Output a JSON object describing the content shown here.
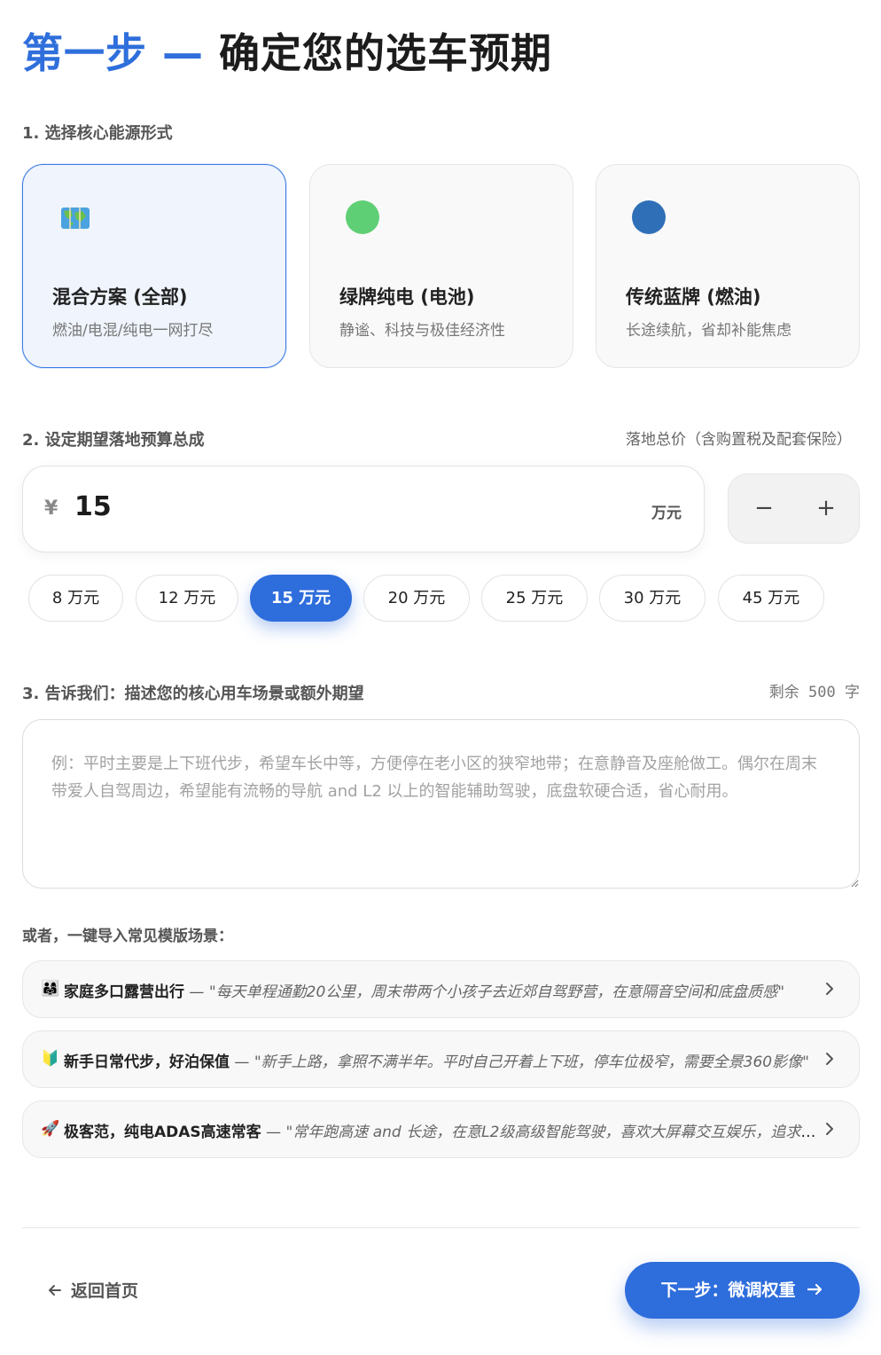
{
  "header": {
    "title_accent": "第一步",
    "title_dash": "—",
    "title_rest": "确定您的选车预期"
  },
  "energy": {
    "label": "1. 选择核心能源形式",
    "options": [
      {
        "title": "混合方案 (全部)",
        "subtitle": "燃油/电混/纯电一网打尽",
        "icon": "world-map-icon",
        "selected": true
      },
      {
        "title": "绿牌纯电 (电池)",
        "subtitle": "静谧、科技与极佳经济性",
        "icon": "green-dot-icon",
        "color": "#5fcf75"
      },
      {
        "title": "传统蓝牌 (燃油)",
        "subtitle": "长途续航，省却补能焦虑",
        "icon": "blue-dot-icon",
        "color": "#2e6fb8"
      }
    ]
  },
  "budget": {
    "label": "2. 设定期望落地预算总成",
    "hint": "落地总价（含购置税及配套保险）",
    "currency": "¥",
    "value": "15",
    "unit": "万元",
    "minus": "−",
    "plus": "+",
    "presets": [
      "8 万元",
      "12 万元",
      "15 万元",
      "20 万元",
      "25 万元",
      "30 万元",
      "45 万元"
    ],
    "active_preset": "15 万元"
  },
  "scene": {
    "label": "3. 告诉我们：描述您的核心用车场景或额外期望",
    "remain_prefix": "剩余",
    "remain_count": "500",
    "remain_suffix": "字",
    "placeholder": "例：平时主要是上下班代步，希望车长中等，方便停在老小区的狭窄地带；在意静音及座舱做工。偶尔在周末带爱人自驾周边，希望能有流畅的导航 and L2 以上的智能辅助驾驶，底盘软硬合适，省心耐用。"
  },
  "templates": {
    "label": "或者，一键导入常见模版场景：",
    "items": [
      {
        "emoji": "👨‍👩‍👧",
        "title": "家庭多口露营出行",
        "sep": " — ",
        "desc": "\"每天单程通勤20公里，周末带两个小孩子去近郊自驾野营，在意隔音空间和底盘质感\""
      },
      {
        "emoji": "🔰",
        "title": "新手日常代步，好泊保值",
        "sep": " — ",
        "desc": "\"新手上路，拿照不满半年。平时自己开着上下班，停车位极窄，需要全景360影像\""
      },
      {
        "emoji": "🚀",
        "title": "极客范，纯电ADAS高速常客",
        "sep": " — ",
        "desc": "\"常年跑高速 and 长途，在意L2级高级智能驾驶，喜欢大屏幕交互娱乐，追求科技感\""
      }
    ]
  },
  "footer": {
    "back_label": "返回首页",
    "next_label": "下一步：微调权重"
  }
}
